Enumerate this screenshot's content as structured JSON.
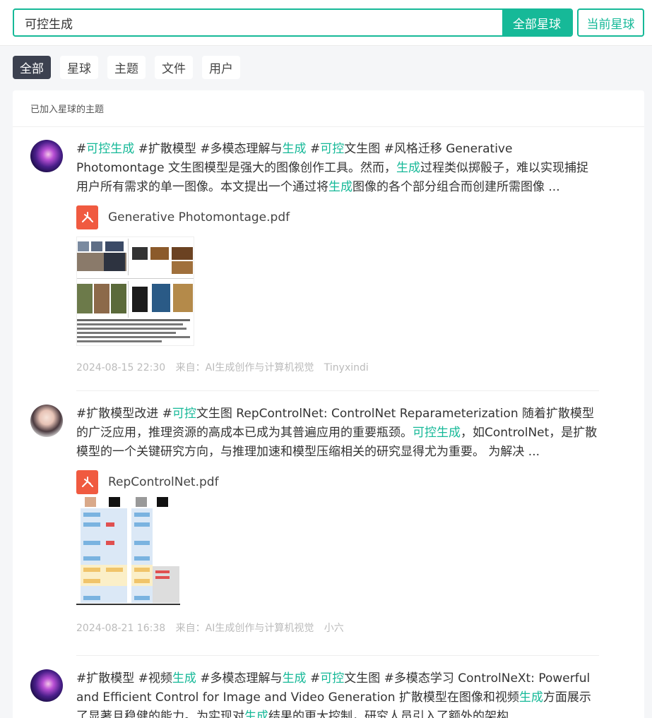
{
  "search": {
    "value": "可控生成",
    "btn_all": "全部星球",
    "btn_current": "当前星球"
  },
  "tabs": [
    "全部",
    "星球",
    "主题",
    "文件",
    "用户"
  ],
  "panel": {
    "header": "已加入星球的主题"
  },
  "posts": [
    {
      "segments": [
        [
          "#",
          ""
        ],
        [
          "可控生成",
          "hl"
        ],
        [
          "  #扩散模型   #多模态理解与",
          ""
        ],
        [
          "生成",
          "hl"
        ],
        [
          "  #",
          ""
        ],
        [
          "可控",
          "hl"
        ],
        [
          "文生图  #风格迁移    Generative Photomontage  文生图模型是强大的图像创作工具。然而，",
          ""
        ],
        [
          "生成",
          "hl"
        ],
        [
          "过程类似掷骰子，难以实现捕捉用户所有需求的单一图像。本文提出一个通过将",
          ""
        ],
        [
          "生成",
          "hl"
        ],
        [
          "图像的各个部分组合而创建所需图像 ...",
          ""
        ]
      ],
      "file_name": "Generative Photomontage.pdf",
      "date": "2024-08-15 22:30",
      "source": "来自：AI生成创作与计算机视觉",
      "author": "Tinyxindi"
    },
    {
      "segments": [
        [
          "#扩散模型改进  #",
          ""
        ],
        [
          "可控",
          "hl"
        ],
        [
          "文生图   RepControlNet: ControlNet Reparameterization  随着扩散模型的广泛应用，推理资源的高成本已成为其普遍应用的重要瓶颈。",
          ""
        ],
        [
          "可控生成",
          "hl"
        ],
        [
          "，如ControlNet，是扩散模型的一个关键研究方向，与推理加速和模型压缩相关的研究显得尤为重要。  为解决 ...",
          ""
        ]
      ],
      "file_name": "RepControlNet.pdf",
      "date": "2024-08-21 16:38",
      "source": "来自：AI生成创作与计算机视觉",
      "author": "小六"
    },
    {
      "segments": [
        [
          "#扩散模型  #视频",
          ""
        ],
        [
          "生成",
          "hl"
        ],
        [
          "   #多模态理解与",
          ""
        ],
        [
          "生成",
          "hl"
        ],
        [
          "  #",
          ""
        ],
        [
          "可控",
          "hl"
        ],
        [
          "文生图  #多模态学习   ControlNeXt: Powerful and Efficient Control for Image and Video Generation  扩散模型在图像和视频",
          ""
        ],
        [
          "生成",
          "hl"
        ],
        [
          "方面展示了显著且稳健的能力。为实现对",
          ""
        ],
        [
          "生成",
          "hl"
        ],
        [
          "结果的更大控制，研究人员引入了额外的架构 ...",
          ""
        ]
      ]
    }
  ]
}
